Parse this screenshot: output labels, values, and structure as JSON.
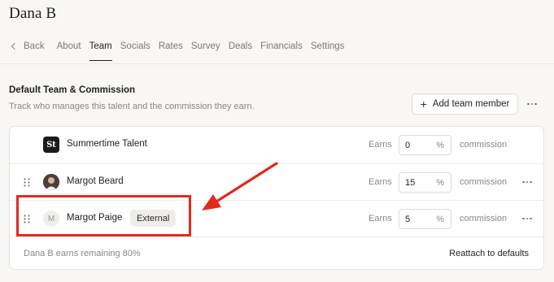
{
  "header": {
    "title": "Dana B"
  },
  "tabs": [
    {
      "label": "Back"
    },
    {
      "label": "About"
    },
    {
      "label": "Team",
      "active": true
    },
    {
      "label": "Socials"
    },
    {
      "label": "Rates"
    },
    {
      "label": "Survey"
    },
    {
      "label": "Deals"
    },
    {
      "label": "Financials"
    },
    {
      "label": "Settings"
    }
  ],
  "section": {
    "title": "Default Team & Commission",
    "subtitle": "Track who manages this talent and the commission they earn.",
    "add_button_label": "Add team member"
  },
  "rows": [
    {
      "name": "Summertime Talent",
      "avatar": "St",
      "earns_label": "Earns",
      "percent": "0",
      "percent_unit": "%",
      "commission_label": "commission"
    },
    {
      "name": "Margot Beard",
      "earns_label": "Earns",
      "percent": "15",
      "percent_unit": "%",
      "commission_label": "commission"
    },
    {
      "name": "Margot Paige",
      "avatar": "M",
      "badge": "External",
      "earns_label": "Earns",
      "percent": "5",
      "percent_unit": "%",
      "commission_label": "commission"
    }
  ],
  "footer": {
    "remaining_text": "Dana B earns remaining 80%",
    "reattach_label": "Reattach to defaults"
  },
  "colors": {
    "annotation": "#e02a1e",
    "background": "#f8f7f5"
  }
}
